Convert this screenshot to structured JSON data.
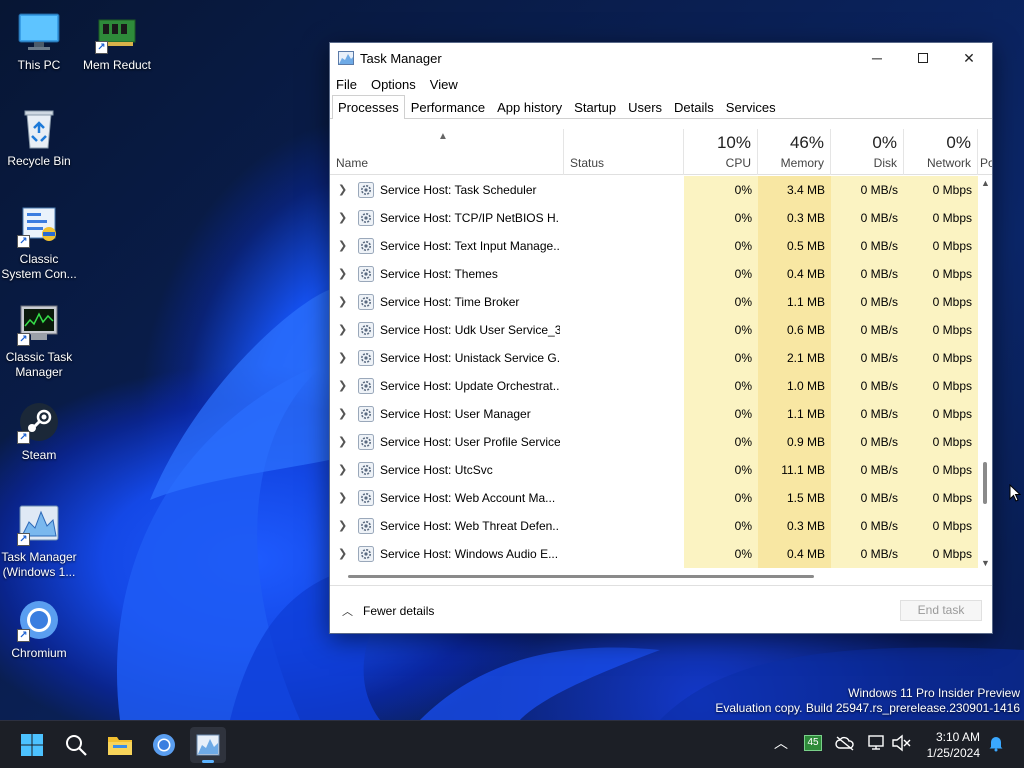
{
  "desktop": {
    "icons": [
      {
        "label": "This PC"
      },
      {
        "label": "Mem Reduct"
      },
      {
        "label": "Recycle Bin"
      },
      {
        "label": "Classic System Con..."
      },
      {
        "label": "Classic Task Manager"
      },
      {
        "label": "Steam"
      },
      {
        "label": "Task Manager (Windows 1..."
      },
      {
        "label": "Chromium"
      }
    ]
  },
  "window": {
    "title": "Task Manager",
    "menu": [
      "File",
      "Options",
      "View"
    ],
    "tabs": [
      "Processes",
      "Performance",
      "App history",
      "Startup",
      "Users",
      "Details",
      "Services"
    ],
    "active_tab": "Processes",
    "columns": {
      "name": "Name",
      "status": "Status",
      "cpu": {
        "pct": "10%",
        "label": "CPU"
      },
      "memory": {
        "pct": "46%",
        "label": "Memory"
      },
      "disk": {
        "pct": "0%",
        "label": "Disk"
      },
      "network": {
        "pct": "0%",
        "label": "Network"
      },
      "power_partial": "Po"
    },
    "rows": [
      {
        "name": "Service Host: Task Scheduler",
        "cpu": "0%",
        "mem": "3.4 MB",
        "disk": "0 MB/s",
        "net": "0 Mbps"
      },
      {
        "name": "Service Host: TCP/IP NetBIOS H...",
        "cpu": "0%",
        "mem": "0.3 MB",
        "disk": "0 MB/s",
        "net": "0 Mbps"
      },
      {
        "name": "Service Host: Text Input Manage...",
        "cpu": "0%",
        "mem": "0.5 MB",
        "disk": "0 MB/s",
        "net": "0 Mbps"
      },
      {
        "name": "Service Host: Themes",
        "cpu": "0%",
        "mem": "0.4 MB",
        "disk": "0 MB/s",
        "net": "0 Mbps"
      },
      {
        "name": "Service Host: Time Broker",
        "cpu": "0%",
        "mem": "1.1 MB",
        "disk": "0 MB/s",
        "net": "0 Mbps"
      },
      {
        "name": "Service Host: Udk User Service_3...",
        "cpu": "0%",
        "mem": "0.6 MB",
        "disk": "0 MB/s",
        "net": "0 Mbps"
      },
      {
        "name": "Service Host: Unistack Service G...",
        "cpu": "0%",
        "mem": "2.1 MB",
        "disk": "0 MB/s",
        "net": "0 Mbps"
      },
      {
        "name": "Service Host: Update Orchestrat...",
        "cpu": "0%",
        "mem": "1.0 MB",
        "disk": "0 MB/s",
        "net": "0 Mbps"
      },
      {
        "name": "Service Host: User Manager",
        "cpu": "0%",
        "mem": "1.1 MB",
        "disk": "0 MB/s",
        "net": "0 Mbps"
      },
      {
        "name": "Service Host: User Profile Service",
        "cpu": "0%",
        "mem": "0.9 MB",
        "disk": "0 MB/s",
        "net": "0 Mbps"
      },
      {
        "name": "Service Host: UtcSvc",
        "cpu": "0%",
        "mem": "11.1 MB",
        "disk": "0 MB/s",
        "net": "0 Mbps"
      },
      {
        "name": "Service Host: Web Account Ma...",
        "cpu": "0%",
        "mem": "1.5 MB",
        "disk": "0 MB/s",
        "net": "0 Mbps"
      },
      {
        "name": "Service Host: Web Threat Defen...",
        "cpu": "0%",
        "mem": "0.3 MB",
        "disk": "0 MB/s",
        "net": "0 Mbps"
      },
      {
        "name": "Service Host: Windows Audio E...",
        "cpu": "0%",
        "mem": "0.4 MB",
        "disk": "0 MB/s",
        "net": "0 Mbps"
      }
    ],
    "footer": {
      "fewer_details": "Fewer details",
      "end_task": "End task"
    }
  },
  "watermark": {
    "line1": "Windows 11 Pro Insider Preview",
    "line2": "Evaluation copy. Build 25947.rs_prerelease.230901-1416"
  },
  "taskbar": {
    "clock_time": "3:10 AM",
    "clock_date": "1/25/2024",
    "tray_badge": "45"
  },
  "colors": {
    "heat_light": "#fbf3c2",
    "heat_mem": "#f8e7a3",
    "taskbar_bg": "#1c1f26",
    "accent": "#5cb3ff"
  }
}
